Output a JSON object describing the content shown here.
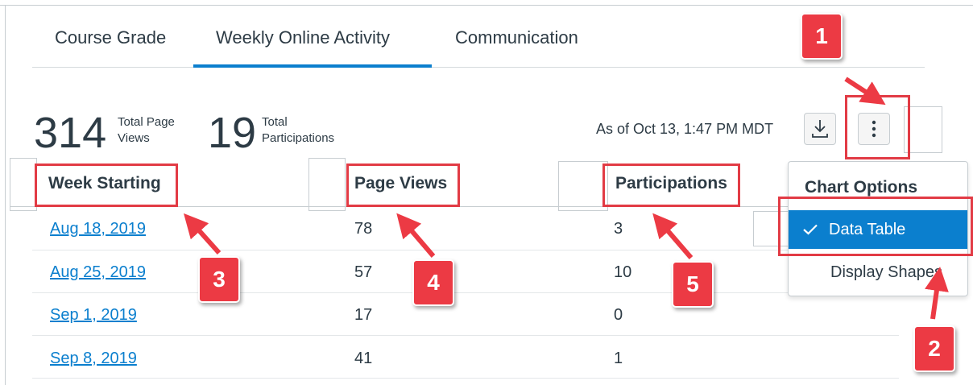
{
  "tabs": [
    {
      "label": "Course Grade"
    },
    {
      "label": "Weekly Online Activity"
    },
    {
      "label": "Communication"
    }
  ],
  "summary": {
    "page_views_value": "314",
    "page_views_label_1": "Total Page",
    "page_views_label_2": "Views",
    "participations_value": "19",
    "participations_label_1": "Total",
    "participations_label_2": "Participations",
    "as_of": "As of Oct 13, 1:47 PM MDT"
  },
  "toolbar": {
    "download_icon": "download-icon",
    "options_icon": "vertical-ellipsis-icon"
  },
  "table": {
    "columns": [
      "Week Starting",
      "Page Views",
      "Participations"
    ],
    "rows": [
      {
        "week": "Aug 18, 2019",
        "page_views": "78",
        "participations": "3"
      },
      {
        "week": "Aug 25, 2019",
        "page_views": "57",
        "participations": "10"
      },
      {
        "week": "Sep 1, 2019",
        "page_views": "17",
        "participations": "0"
      },
      {
        "week": "Sep 8, 2019",
        "page_views": "41",
        "participations": "1"
      }
    ]
  },
  "menu": {
    "title": "Chart Options",
    "items": [
      {
        "label": "Data Table",
        "checked": true
      },
      {
        "label": "Display Shapes",
        "checked": false
      }
    ]
  },
  "annotations": {
    "badges": [
      "1",
      "2",
      "3",
      "4",
      "5"
    ],
    "color": "#ec3a44"
  },
  "colors": {
    "accent": "#0b7fce",
    "text": "#2d3b45",
    "annotation": "#e23b45"
  }
}
